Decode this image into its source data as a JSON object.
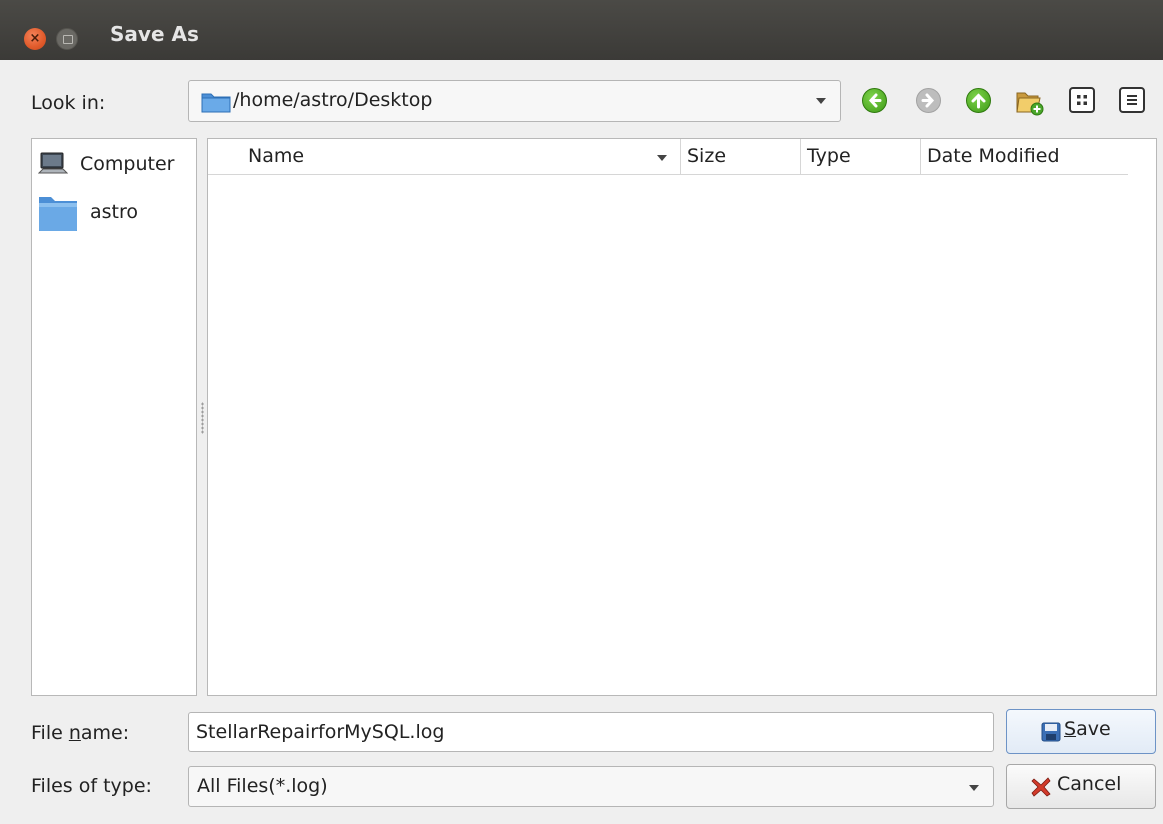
{
  "window": {
    "title": "Save As",
    "close_glyph": "×"
  },
  "look_in": {
    "label": "Look in:",
    "path": "/home/astro/Desktop"
  },
  "toolbar": {
    "back_icon": "back-arrow-icon",
    "forward_icon": "forward-arrow-icon",
    "up_icon": "up-arrow-icon",
    "new_folder_icon": "new-folder-icon",
    "list_view_icon": "list-view-icon",
    "detail_view_icon": "detail-view-icon"
  },
  "sidebar": {
    "items": [
      {
        "label": "Computer",
        "icon": "computer-icon"
      },
      {
        "label": "astro",
        "icon": "folder-icon"
      }
    ]
  },
  "file_list": {
    "columns": [
      "Name",
      "Size",
      "Type",
      "Date Modified"
    ],
    "rows": []
  },
  "file_name": {
    "label_prefix": "File ",
    "label_mnemonic": "n",
    "label_suffix": "ame:",
    "value": "StellarRepairforMySQL.log"
  },
  "file_type": {
    "label": "Files of type:",
    "value": "All Files(*.log)"
  },
  "buttons": {
    "save_mnemonic": "S",
    "save_rest": "ave",
    "cancel_label": "Cancel"
  },
  "colors": {
    "accent_green": "#3e9a17",
    "folder_blue": "#5b9bd5",
    "titlebar": "#3f3e3b"
  }
}
